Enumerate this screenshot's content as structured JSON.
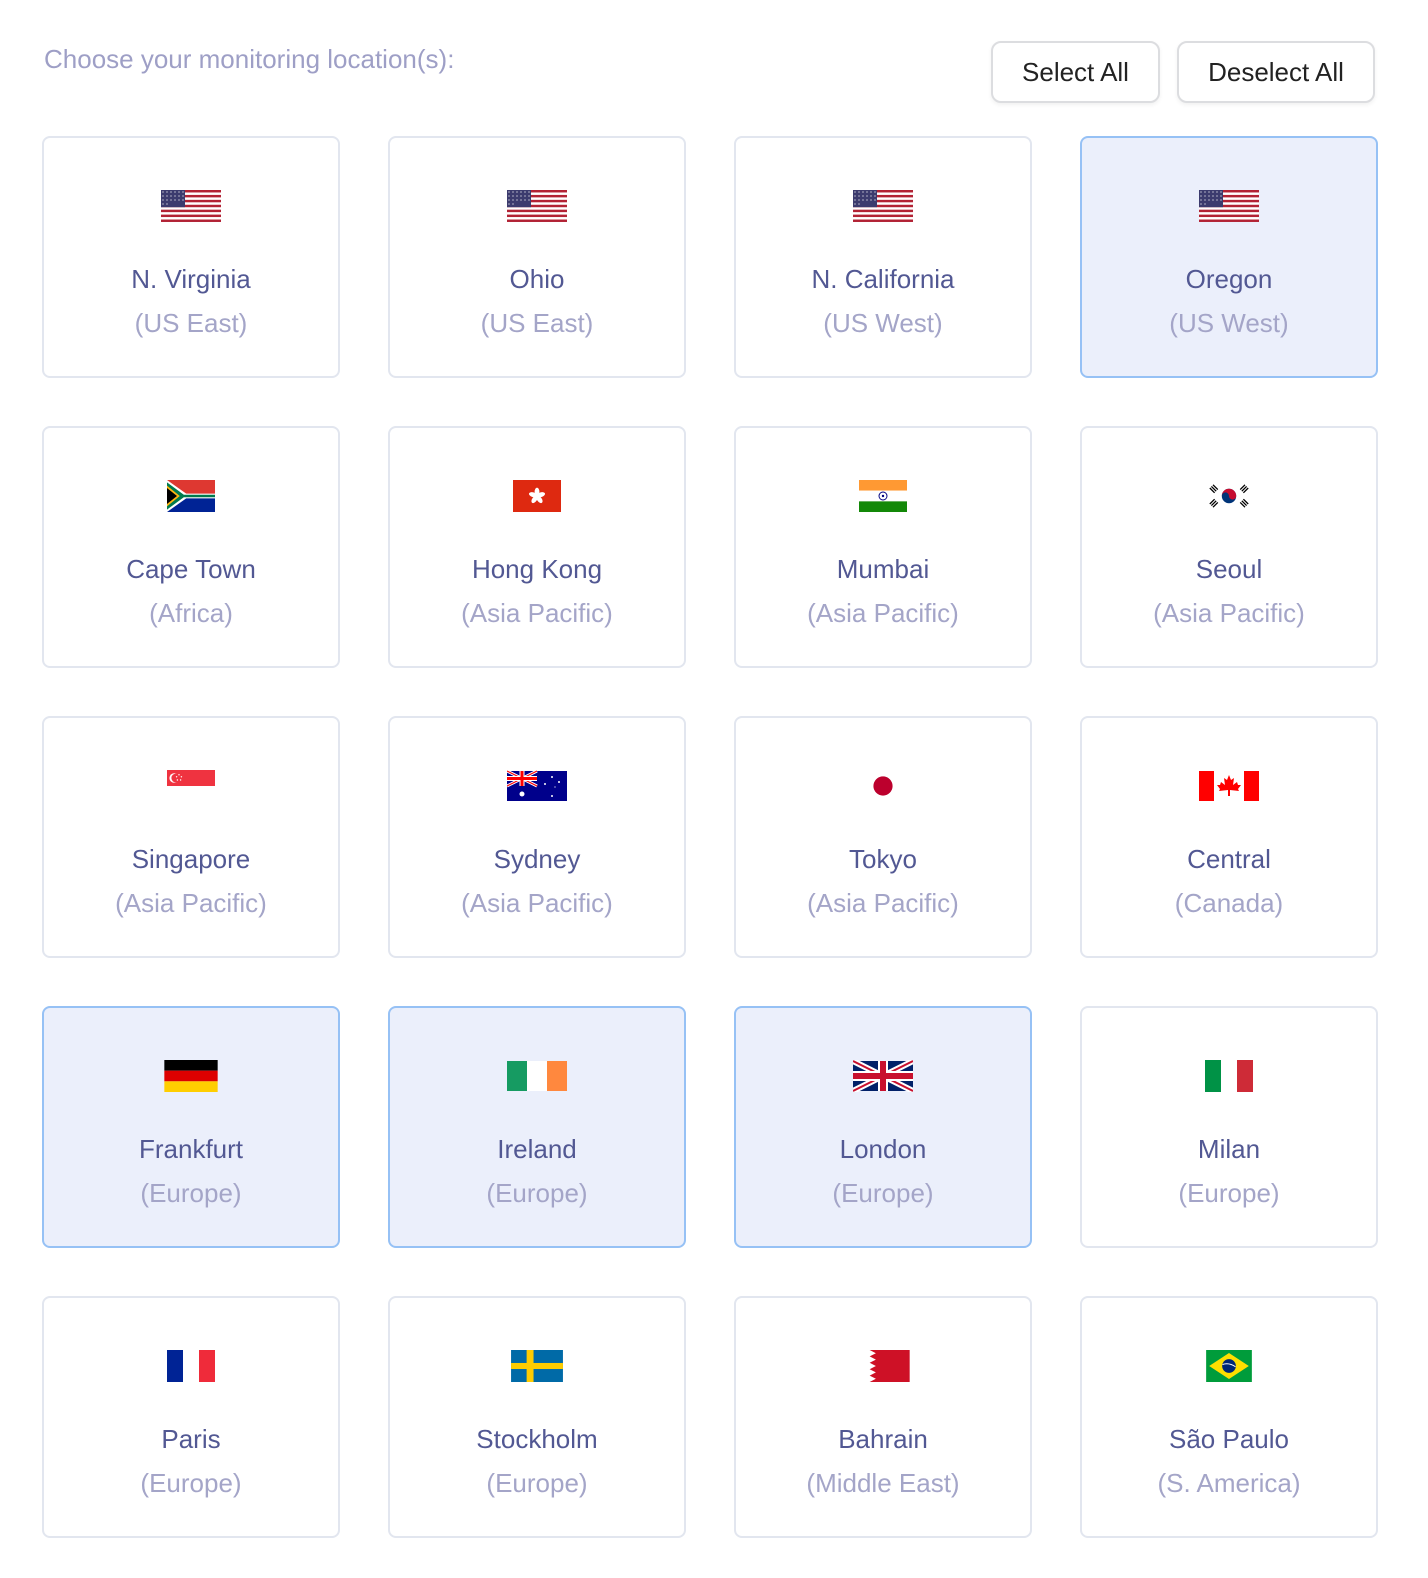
{
  "header": {
    "label": "Choose your monitoring location(s):",
    "select_all_label": "Select All",
    "deselect_all_label": "Deselect All"
  },
  "colors": {
    "selected_bg": "#ebeffb",
    "selected_border": "#96c1f5",
    "city_text": "#525893",
    "region_text": "#a4a5c8"
  },
  "locations": [
    {
      "city": "N. Virginia",
      "region": "(US East)",
      "flag": "us-flag-icon",
      "selected": false
    },
    {
      "city": "Ohio",
      "region": "(US East)",
      "flag": "us-flag-icon",
      "selected": false
    },
    {
      "city": "N. California",
      "region": "(US West)",
      "flag": "us-flag-icon",
      "selected": false
    },
    {
      "city": "Oregon",
      "region": "(US West)",
      "flag": "us-flag-icon",
      "selected": true
    },
    {
      "city": "Cape Town",
      "region": "(Africa)",
      "flag": "za-flag-icon",
      "selected": false
    },
    {
      "city": "Hong Kong",
      "region": "(Asia Pacific)",
      "flag": "hk-flag-icon",
      "selected": false
    },
    {
      "city": "Mumbai",
      "region": "(Asia Pacific)",
      "flag": "in-flag-icon",
      "selected": false
    },
    {
      "city": "Seoul",
      "region": "(Asia Pacific)",
      "flag": "kr-flag-icon",
      "selected": false
    },
    {
      "city": "Singapore",
      "region": "(Asia Pacific)",
      "flag": "sg-flag-icon",
      "selected": false
    },
    {
      "city": "Sydney",
      "region": "(Asia Pacific)",
      "flag": "au-flag-icon",
      "selected": false
    },
    {
      "city": "Tokyo",
      "region": "(Asia Pacific)",
      "flag": "jp-flag-icon",
      "selected": false
    },
    {
      "city": "Central",
      "region": "(Canada)",
      "flag": "ca-flag-icon",
      "selected": false
    },
    {
      "city": "Frankfurt",
      "region": "(Europe)",
      "flag": "de-flag-icon",
      "selected": true
    },
    {
      "city": "Ireland",
      "region": "(Europe)",
      "flag": "ie-flag-icon",
      "selected": true
    },
    {
      "city": "London",
      "region": "(Europe)",
      "flag": "gb-flag-icon",
      "selected": true
    },
    {
      "city": "Milan",
      "region": "(Europe)",
      "flag": "it-flag-icon",
      "selected": false
    },
    {
      "city": "Paris",
      "region": "(Europe)",
      "flag": "fr-flag-icon",
      "selected": false
    },
    {
      "city": "Stockholm",
      "region": "(Europe)",
      "flag": "se-flag-icon",
      "selected": false
    },
    {
      "city": "Bahrain",
      "region": "(Middle East)",
      "flag": "bh-flag-icon",
      "selected": false
    },
    {
      "city": "São Paulo",
      "region": "(S. America)",
      "flag": "br-flag-icon",
      "selected": false
    }
  ]
}
